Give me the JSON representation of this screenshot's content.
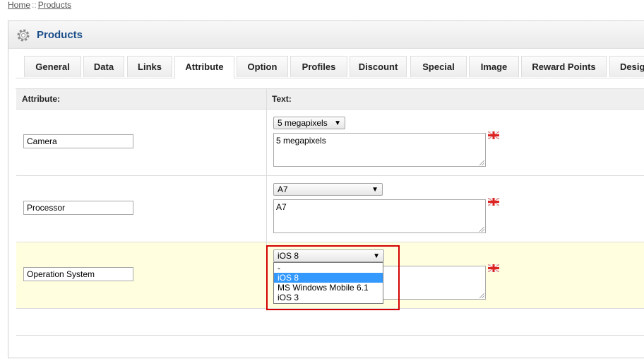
{
  "breadcrumb": {
    "home": "Home",
    "separator": "::",
    "current": "Products"
  },
  "heading": {
    "title": "Products",
    "icon": "gear-icon"
  },
  "tabs": [
    {
      "label": "General"
    },
    {
      "label": "Data"
    },
    {
      "label": "Links"
    },
    {
      "label": "Attribute",
      "active": true
    },
    {
      "label": "Option"
    },
    {
      "label": "Profiles"
    },
    {
      "label": "Discount"
    },
    {
      "label": "Special"
    },
    {
      "label": "Image"
    },
    {
      "label": "Reward Points"
    },
    {
      "label": "Desig"
    }
  ],
  "table": {
    "col_attribute": "Attribute:",
    "col_text": "Text:",
    "rows": [
      {
        "attribute": "Camera",
        "select_value": "5 megapixels",
        "text": "5 megapixels"
      },
      {
        "attribute": "Processor",
        "select_value": "A7",
        "text": "A7"
      },
      {
        "attribute": "Operation System",
        "select_value": "iOS 8",
        "text": ""
      }
    ]
  },
  "dropdown": {
    "options": [
      "-",
      "iOS 8",
      "MS Windows Mobile 6.1",
      "iOS 3"
    ],
    "selected": "iOS 8"
  },
  "colors": {
    "title": "#1a4e8a",
    "highlight_row": "#ffffe0",
    "selected_option": "#3399ff",
    "annotation": "#d40000"
  }
}
